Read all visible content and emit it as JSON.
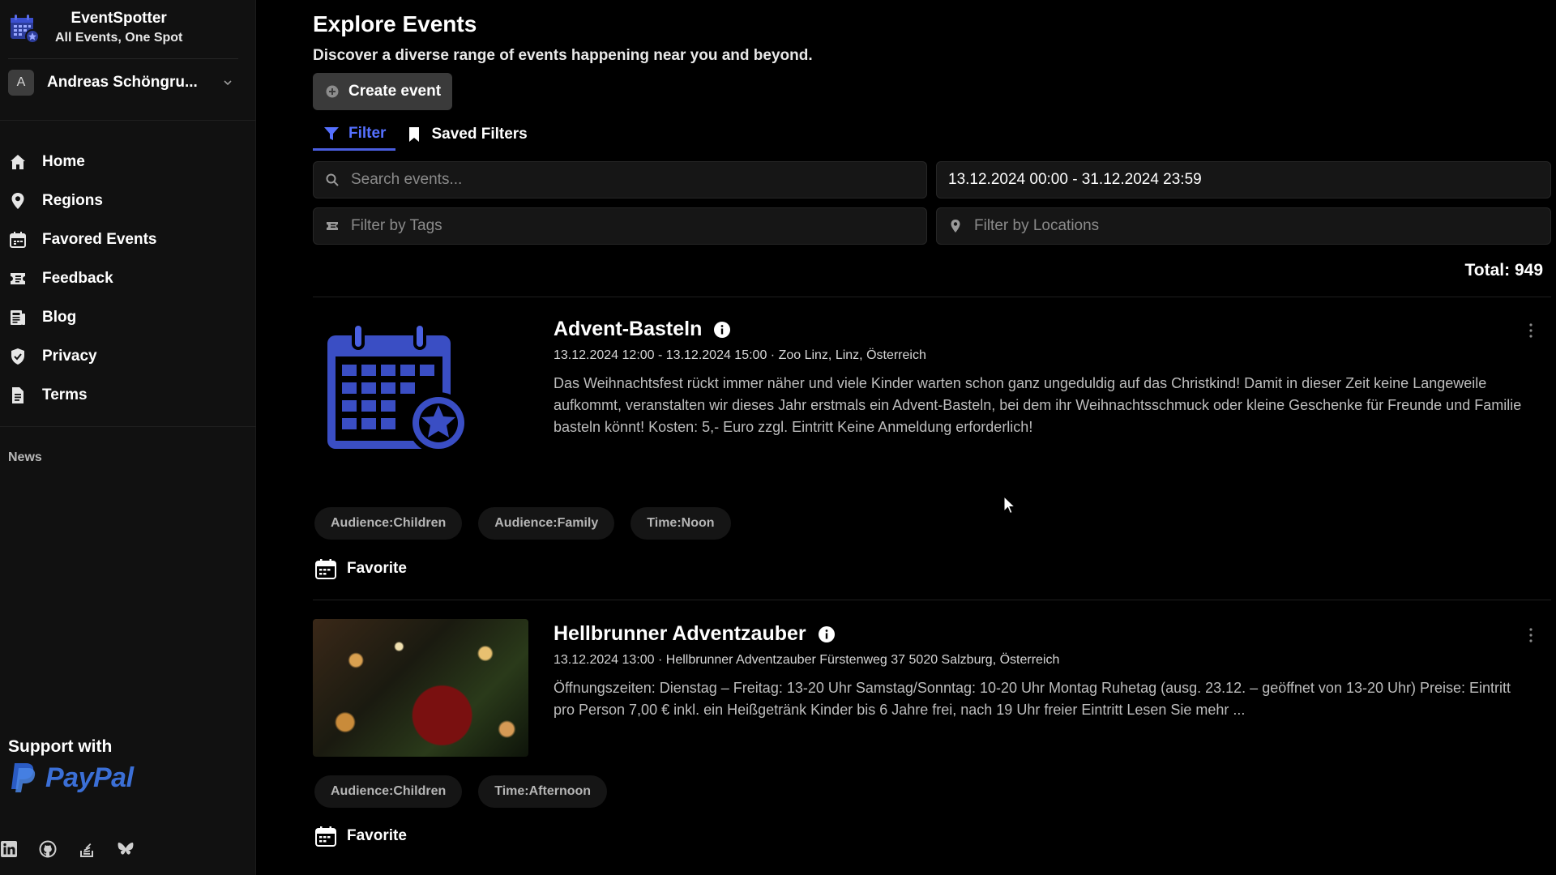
{
  "brand": {
    "title": "EventSpotter",
    "subtitle": "All Events, One Spot",
    "logo_icon": "calendar-logo-icon"
  },
  "user": {
    "initial": "A",
    "name": "Andreas Schöngru..."
  },
  "nav": [
    {
      "label": "Home",
      "icon": "home-icon"
    },
    {
      "label": "Regions",
      "icon": "map-pin-icon"
    },
    {
      "label": "Favored Events",
      "icon": "calendar-icon"
    },
    {
      "label": "Feedback",
      "icon": "ticket-icon"
    },
    {
      "label": "Blog",
      "icon": "newspaper-icon"
    },
    {
      "label": "Privacy",
      "icon": "shield-icon"
    },
    {
      "label": "Terms",
      "icon": "document-icon"
    }
  ],
  "news_label": "News",
  "support": {
    "label": "Support with",
    "brand": "PayPal"
  },
  "socials": [
    "linkedin-icon",
    "github-icon",
    "stackoverflow-icon",
    "bluesky-icon"
  ],
  "page": {
    "title": "Explore Events",
    "subtitle": "Discover a diverse range of events happening near you and beyond.",
    "create_label": "Create event"
  },
  "tabs": [
    {
      "label": "Filter",
      "icon": "filter-icon",
      "active": true
    },
    {
      "label": "Saved Filters",
      "icon": "bookmark-icon",
      "active": false
    }
  ],
  "filters": {
    "search_placeholder": "Search events...",
    "date_range": "13.12.2024 00:00 - 31.12.2024 23:59",
    "tags_placeholder": "Filter by Tags",
    "locations_placeholder": "Filter by Locations"
  },
  "total": "Total: 949",
  "colors": {
    "accent": "#5570ff",
    "background": "#000000",
    "sidebar": "#111111"
  },
  "events": [
    {
      "title": "Advent-Basteln",
      "meta": "13.12.2024 12:00 - 13.12.2024 15:00 · Zoo Linz, Linz, Österreich",
      "description": "Das Weihnachtsfest rückt immer näher und viele Kinder warten schon ganz ungeduldig auf das Christkind! Damit in dieser Zeit keine Langeweile aufkommt, veranstalten wir dieses Jahr erstmals ein Advent-Basteln, bei dem ihr Weihnachtsschmuck oder kleine Geschenke für Freunde und Familie basteln könnt! Kosten: 5,- Euro zzgl. Eintritt Keine Anmeldung erforderlich!",
      "tags": [
        "Audience:Children",
        "Audience:Family",
        "Time:Noon"
      ],
      "favorite_label": "Favorite",
      "thumb_icon": "calendar-star-icon"
    },
    {
      "title": "Hellbrunner Adventzauber",
      "meta": "13.12.2024 13:00 · Hellbrunner Adventzauber Fürstenweg 37 5020 Salzburg, Österreich",
      "description": "Öffnungszeiten: Dienstag – Freitag: 13-20 Uhr Samstag/Sonntag: 10-20 Uhr Montag Ruhetag (ausg. 23.12. – geöffnet von 13-20 Uhr) Preise: Eintritt pro Person 7,00 € inkl. ein Heißgetränk Kinder bis 6 Jahre frei, nach 19 Uhr freier Eintritt Lesen Sie mehr ...",
      "tags": [
        "Audience:Children",
        "Time:Afternoon"
      ],
      "favorite_label": "Favorite",
      "thumb_icon": "christmas-photo"
    }
  ]
}
